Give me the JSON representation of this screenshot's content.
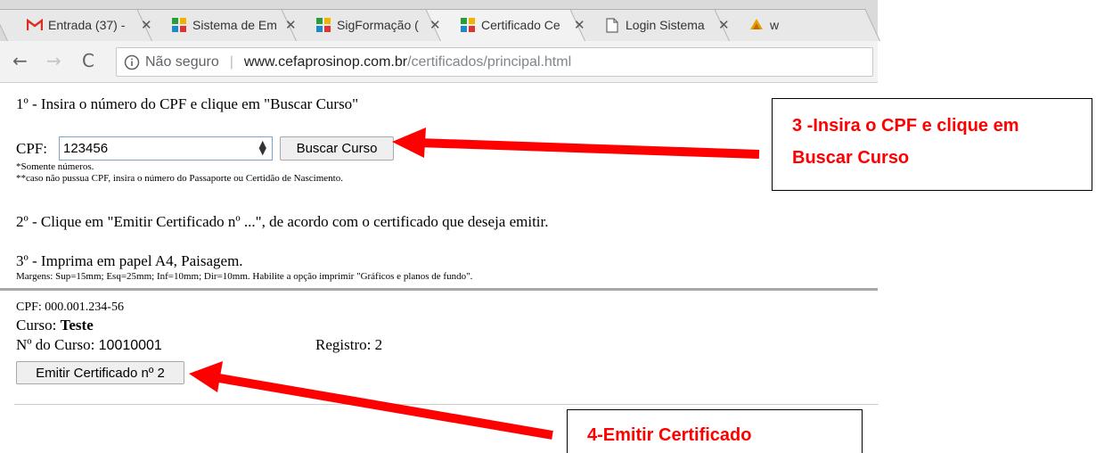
{
  "browser": {
    "tabs": [
      {
        "title": "Entrada (37) -",
        "icon": "gmail-icon"
      },
      {
        "title": "Sistema de Em",
        "icon": "site-icon"
      },
      {
        "title": "SigFormação (",
        "icon": "site-icon"
      },
      {
        "title": "Certificado Ce",
        "icon": "site-icon"
      },
      {
        "title": "Login Sistema",
        "icon": "page-icon"
      },
      {
        "title": "w",
        "icon": "pma-icon"
      }
    ],
    "address": {
      "security_label": "Não seguro",
      "url_host": "www.cefaprosinop.com.br",
      "url_path": "/certificados/principal.html"
    }
  },
  "page": {
    "step1": "1º - Insira o número do CPF e clique em \"Buscar Curso\"",
    "cpf_label": "CPF:",
    "cpf_value": "123456",
    "search_button": "Buscar Curso",
    "note1": "*Somente números.",
    "note2": "**caso não pussua CPF, insira o número do Passaporte ou Certidão de Nascimento.",
    "step2": "2º - Clique em \"Emitir Certificado nº ...\", de acordo com o certificado que deseja emitir.",
    "step3": "3º - Imprima em papel A4, Paisagem.",
    "margins_note": "Margens: Sup=15mm; Esq=25mm; Inf=10mm; Dir=10mm. Habilite a opção imprimir \"Gráficos e planos de fundo\".",
    "result": {
      "cpf_line": "CPF: 000.001.234-56",
      "course_label": "Curso:",
      "course_name": "Teste",
      "course_number_label": "Nº do Curso:",
      "course_number": "10010001",
      "registration": "Registro: 2",
      "emit_button": "Emitir Certificado nº 2"
    }
  },
  "annotations": {
    "callout3_line1": "3 -Insira o CPF e clique em",
    "callout3_line2": "Buscar Curso",
    "callout4": "4-Emitir Certificado",
    "color": "#ff0000"
  }
}
